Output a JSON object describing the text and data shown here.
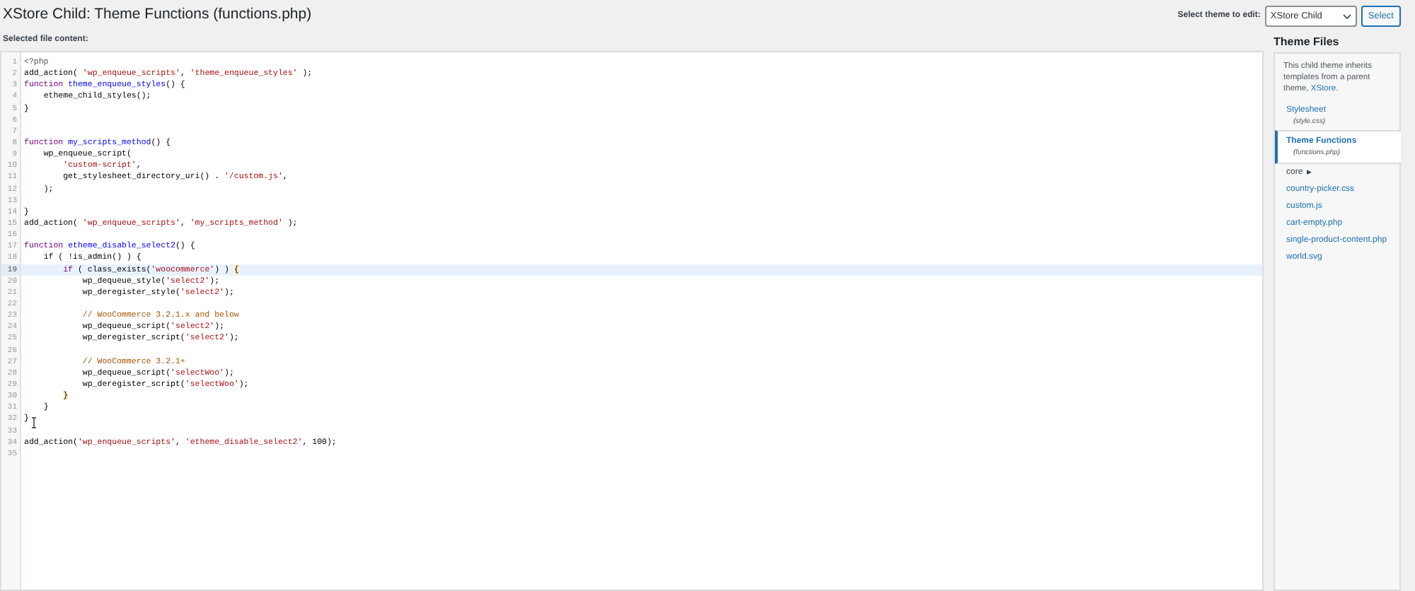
{
  "title": "XStore Child: Theme Functions (functions.php)",
  "theme_picker": {
    "label": "Select theme to edit:",
    "value": "XStore Child",
    "button": "Select"
  },
  "editor": {
    "label": "Selected file content:",
    "lines": [
      {
        "number": "1",
        "active": false,
        "tokens": [
          {
            "kind": "meta",
            "text": "<?php"
          }
        ]
      },
      {
        "number": "2",
        "active": false,
        "tokens": [
          {
            "kind": "plain",
            "text": "add_action( "
          },
          {
            "kind": "string",
            "text": "'wp_enqueue_scripts'"
          },
          {
            "kind": "plain",
            "text": ", "
          },
          {
            "kind": "string",
            "text": "'theme_enqueue_styles'"
          },
          {
            "kind": "plain",
            "text": " );"
          }
        ]
      },
      {
        "number": "3",
        "active": false,
        "tokens": [
          {
            "kind": "keyword",
            "text": "function "
          },
          {
            "kind": "def",
            "text": "theme_enqueue_styles"
          },
          {
            "kind": "plain",
            "text": "() {"
          }
        ]
      },
      {
        "number": "4",
        "active": false,
        "tokens": [
          {
            "kind": "plain",
            "text": "    etheme_child_styles();"
          }
        ]
      },
      {
        "number": "5",
        "active": false,
        "tokens": [
          {
            "kind": "plain",
            "text": "}"
          }
        ]
      },
      {
        "number": "6",
        "active": false
      },
      {
        "number": "7",
        "active": false
      },
      {
        "number": "8",
        "active": false,
        "tokens": [
          {
            "kind": "keyword",
            "text": "function "
          },
          {
            "kind": "def",
            "text": "my_scripts_method"
          },
          {
            "kind": "plain",
            "text": "() {"
          }
        ]
      },
      {
        "number": "9",
        "active": false,
        "tokens": [
          {
            "kind": "plain",
            "text": "    wp_enqueue_script("
          }
        ]
      },
      {
        "number": "10",
        "active": false,
        "tokens": [
          {
            "kind": "string",
            "text": "        'custom-script'"
          },
          {
            "kind": "plain",
            "text": ","
          }
        ]
      },
      {
        "number": "11",
        "active": false,
        "tokens": [
          {
            "kind": "plain",
            "text": "        get_stylesheet_directory_uri() . "
          },
          {
            "kind": "string",
            "text": "'/custom.js'"
          },
          {
            "kind": "plain",
            "text": ","
          }
        ]
      },
      {
        "number": "12",
        "active": false,
        "tokens": [
          {
            "kind": "plain",
            "text": "    );"
          }
        ]
      },
      {
        "number": "13",
        "active": false
      },
      {
        "number": "14",
        "active": false,
        "tokens": [
          {
            "kind": "plain",
            "text": "}"
          }
        ]
      },
      {
        "number": "15",
        "active": false,
        "tokens": [
          {
            "kind": "plain",
            "text": "add_action( "
          },
          {
            "kind": "string",
            "text": "'wp_enqueue_scripts'"
          },
          {
            "kind": "plain",
            "text": ", "
          },
          {
            "kind": "string",
            "text": "'my_scripts_method'"
          },
          {
            "kind": "plain",
            "text": " );"
          }
        ]
      },
      {
        "number": "16",
        "active": false
      },
      {
        "number": "17",
        "active": false,
        "tokens": [
          {
            "kind": "keyword",
            "text": "function "
          },
          {
            "kind": "def",
            "text": "etheme_disable_select2"
          },
          {
            "kind": "plain",
            "text": "() {"
          }
        ]
      },
      {
        "number": "18",
        "active": false,
        "tokens": [
          {
            "kind": "plain",
            "text": "    if ( !is_admin() ) {"
          }
        ]
      },
      {
        "number": "19",
        "active": true,
        "tokens": [
          {
            "kind": "keyword",
            "text": "        if"
          },
          {
            "kind": "plain",
            "text": " ( class_exists("
          },
          {
            "kind": "string",
            "text": "'woocommerce'"
          },
          {
            "kind": "plain",
            "text": ") ) "
          },
          {
            "kind": "match",
            "text": "{"
          }
        ]
      },
      {
        "number": "20",
        "active": false,
        "tokens": [
          {
            "kind": "plain",
            "text": "            wp_dequeue_style("
          },
          {
            "kind": "string",
            "text": "'select2'"
          },
          {
            "kind": "plain",
            "text": ");"
          }
        ]
      },
      {
        "number": "21",
        "active": false,
        "tokens": [
          {
            "kind": "plain",
            "text": "            wp_deregister_style("
          },
          {
            "kind": "string",
            "text": "'select2'"
          },
          {
            "kind": "plain",
            "text": ");"
          }
        ]
      },
      {
        "number": "22",
        "active": false
      },
      {
        "number": "23",
        "active": false,
        "tokens": [
          {
            "kind": "comment",
            "text": "            // WooCommerce 3.2.1.x and below"
          }
        ]
      },
      {
        "number": "24",
        "active": false,
        "tokens": [
          {
            "kind": "plain",
            "text": "            wp_dequeue_script("
          },
          {
            "kind": "string",
            "text": "'select2'"
          },
          {
            "kind": "plain",
            "text": ");"
          }
        ]
      },
      {
        "number": "25",
        "active": false,
        "tokens": [
          {
            "kind": "plain",
            "text": "            wp_deregister_script("
          },
          {
            "kind": "string",
            "text": "'select2'"
          },
          {
            "kind": "plain",
            "text": ");"
          }
        ]
      },
      {
        "number": "26",
        "active": false
      },
      {
        "number": "27",
        "active": false,
        "tokens": [
          {
            "kind": "comment",
            "text": "            // WooCommerce 3.2.1+"
          }
        ]
      },
      {
        "number": "28",
        "active": false,
        "tokens": [
          {
            "kind": "plain",
            "text": "            wp_dequeue_script("
          },
          {
            "kind": "string",
            "text": "'selectWoo'"
          },
          {
            "kind": "plain",
            "text": ");"
          }
        ]
      },
      {
        "number": "29",
        "active": false,
        "tokens": [
          {
            "kind": "plain",
            "text": "            wp_deregister_script("
          },
          {
            "kind": "string",
            "text": "'selectWoo'"
          },
          {
            "kind": "plain",
            "text": ");"
          }
        ]
      },
      {
        "number": "30",
        "active": false,
        "tokens": [
          {
            "kind": "match",
            "text": "        }"
          }
        ]
      },
      {
        "number": "31",
        "active": false,
        "tokens": [
          {
            "kind": "plain",
            "text": "    }"
          }
        ]
      },
      {
        "number": "32",
        "active": false,
        "tokens": [
          {
            "kind": "plain",
            "text": "}"
          }
        ]
      },
      {
        "number": "33",
        "active": false
      },
      {
        "number": "34",
        "active": false,
        "tokens": [
          {
            "kind": "plain",
            "text": "add_action("
          },
          {
            "kind": "string",
            "text": "'wp_enqueue_scripts'"
          },
          {
            "kind": "plain",
            "text": ", "
          },
          {
            "kind": "string",
            "text": "'etheme_disable_select2'"
          },
          {
            "kind": "plain",
            "text": ", 100);"
          }
        ]
      },
      {
        "number": "35",
        "active": false
      }
    ]
  },
  "sidebar": {
    "title": "Theme Files",
    "note": "This child theme inherits templates from a parent theme, ",
    "note_link": "XStore.",
    "files": [
      {
        "kind": "file",
        "label": "Stylesheet",
        "filename": "(style.css)",
        "selected": false
      },
      {
        "kind": "file",
        "label": "Theme Functions",
        "filename": "(functions.php)",
        "selected": true
      },
      {
        "kind": "folder",
        "label": "core",
        "expander": "▶",
        "selected": false
      },
      {
        "kind": "file",
        "label": "country-picker.css",
        "selected": false
      },
      {
        "kind": "file",
        "label": "custom.js",
        "selected": false
      },
      {
        "kind": "file",
        "label": "cart-empty.php",
        "selected": false
      },
      {
        "kind": "file",
        "label": "single-product-content.php",
        "selected": false
      },
      {
        "kind": "file",
        "label": "world.svg",
        "selected": false
      }
    ]
  }
}
